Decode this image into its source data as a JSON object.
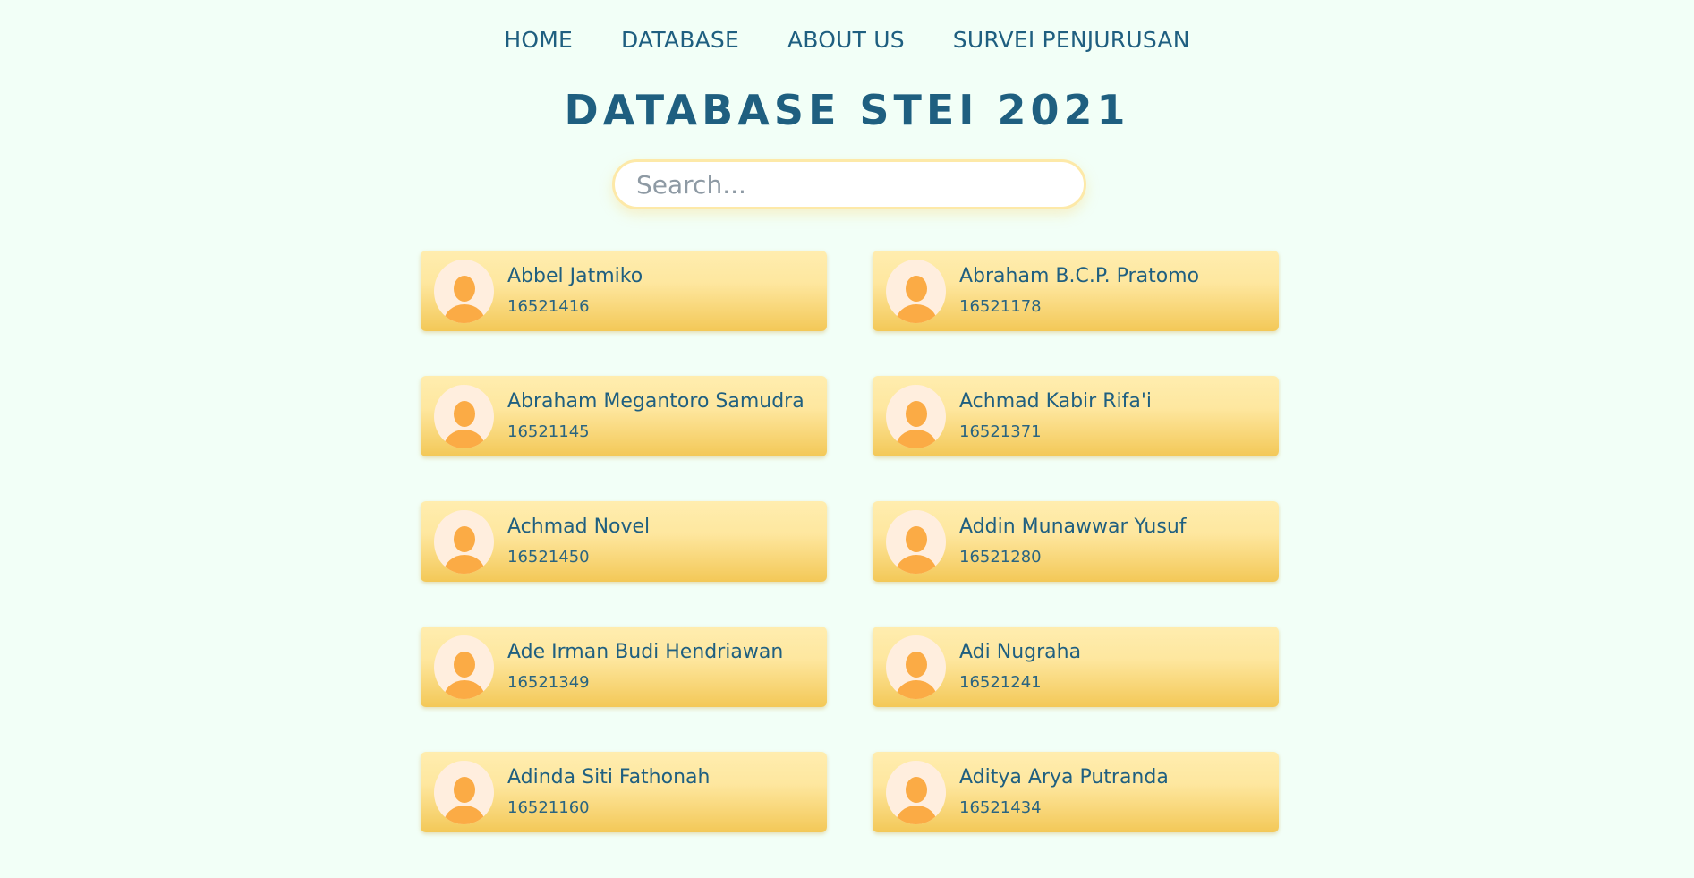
{
  "nav": {
    "items": [
      "HOME",
      "DATABASE",
      "ABOUT US",
      "SURVEI PENJURUSAN"
    ]
  },
  "page_title": "DATABASE STEI 2021",
  "search": {
    "placeholder": "Search...",
    "value": ""
  },
  "students": [
    {
      "name": "Abbel Jatmiko",
      "nim": "16521416"
    },
    {
      "name": "Abraham B.C.P. Pratomo",
      "nim": "16521178"
    },
    {
      "name": "Abraham Megantoro Samudra",
      "nim": "16521145"
    },
    {
      "name": "Achmad Kabir Rifa'i",
      "nim": "16521371"
    },
    {
      "name": "Achmad Novel",
      "nim": "16521450"
    },
    {
      "name": "Addin Munawwar Yusuf",
      "nim": "16521280"
    },
    {
      "name": "Ade Irman Budi Hendriawan",
      "nim": "16521349"
    },
    {
      "name": "Adi Nugraha",
      "nim": "16521241"
    },
    {
      "name": "Adinda Siti Fathonah",
      "nim": "16521160"
    },
    {
      "name": "Aditya Arya Putranda",
      "nim": "16521434"
    }
  ],
  "colors": {
    "background": "#f2fff7",
    "text_primary": "#1f5f80",
    "card_top": "#ffedaf",
    "card_bottom": "#f3c857",
    "avatar_bg": "#ffeede",
    "avatar_figure": "#fbab45"
  },
  "icons": {
    "avatar": "user-avatar-icon"
  }
}
